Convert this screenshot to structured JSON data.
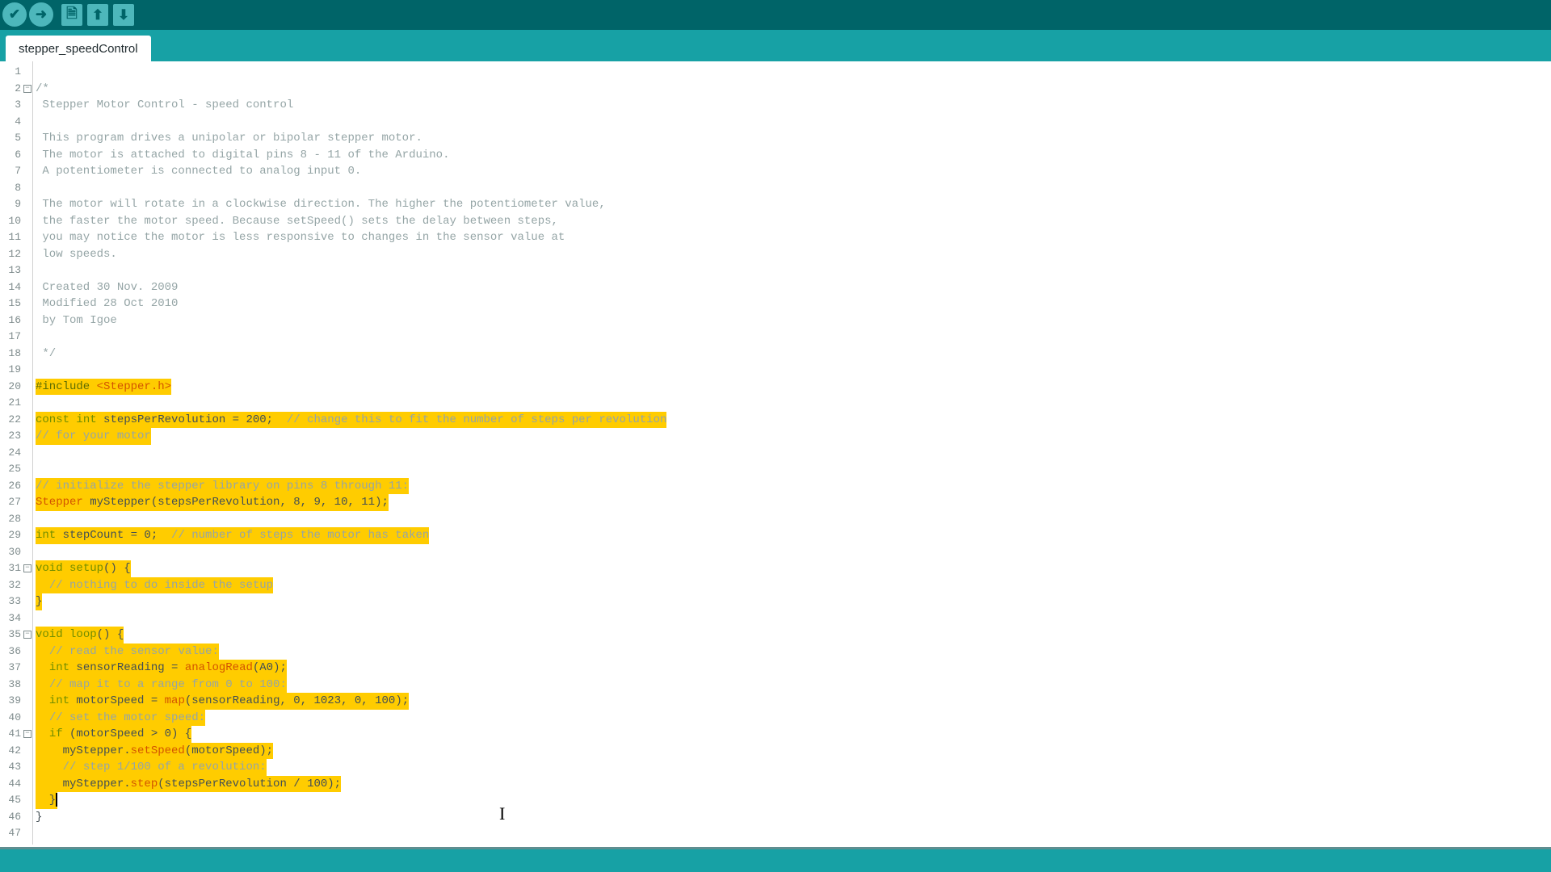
{
  "toolbar": {
    "buttons": [
      {
        "name": "verify",
        "icon": "checkmark-icon",
        "glyph": "✔"
      },
      {
        "name": "upload",
        "icon": "arrow-right-icon",
        "glyph": "➜"
      },
      {
        "name": "new",
        "icon": "new-file-icon",
        "glyph": "🗎"
      },
      {
        "name": "open",
        "icon": "arrow-up-icon",
        "glyph": "⬆"
      },
      {
        "name": "save",
        "icon": "arrow-down-icon",
        "glyph": "⬇"
      }
    ]
  },
  "tab": {
    "label": "stepper_speedControl"
  },
  "colors": {
    "toolbar": "#006468",
    "tabbar": "#17a1a5",
    "selection": "#ffcc00",
    "comment": "#95a5a6",
    "keyword": "#728e00",
    "function": "#d35400"
  },
  "editor": {
    "lines": [
      {
        "n": "1",
        "t": []
      },
      {
        "n": "2",
        "fold": true,
        "t": [
          [
            "comment",
            "/*"
          ]
        ]
      },
      {
        "n": "3",
        "t": [
          [
            "comment",
            " Stepper Motor Control - speed control"
          ]
        ]
      },
      {
        "n": "4",
        "t": []
      },
      {
        "n": "5",
        "t": [
          [
            "comment",
            " This program drives a unipolar or bipolar stepper motor."
          ]
        ]
      },
      {
        "n": "6",
        "t": [
          [
            "comment",
            " The motor is attached to digital pins 8 - 11 of the Arduino."
          ]
        ]
      },
      {
        "n": "7",
        "t": [
          [
            "comment",
            " A potentiometer is connected to analog input 0."
          ]
        ]
      },
      {
        "n": "8",
        "t": []
      },
      {
        "n": "9",
        "t": [
          [
            "comment",
            " The motor will rotate in a clockwise direction. The higher the potentiometer value,"
          ]
        ]
      },
      {
        "n": "10",
        "t": [
          [
            "comment",
            " the faster the motor speed. Because setSpeed() sets the delay between steps,"
          ]
        ]
      },
      {
        "n": "11",
        "t": [
          [
            "comment",
            " you may notice the motor is less responsive to changes in the sensor value at"
          ]
        ]
      },
      {
        "n": "12",
        "t": [
          [
            "comment",
            " low speeds."
          ]
        ]
      },
      {
        "n": "13",
        "t": []
      },
      {
        "n": "14",
        "t": [
          [
            "comment",
            " Created 30 Nov. 2009"
          ]
        ]
      },
      {
        "n": "15",
        "t": [
          [
            "comment",
            " Modified 28 Oct 2010"
          ]
        ]
      },
      {
        "n": "16",
        "t": [
          [
            "comment",
            " by Tom Igoe"
          ]
        ]
      },
      {
        "n": "17",
        "t": []
      },
      {
        "n": "18",
        "t": [
          [
            "comment",
            " */"
          ]
        ]
      },
      {
        "n": "19",
        "t": []
      },
      {
        "n": "20",
        "sel": true,
        "t": [
          [
            "pre",
            "#include "
          ],
          [
            "fn",
            "<Stepper.h>"
          ]
        ]
      },
      {
        "n": "21",
        "sel": true,
        "t": []
      },
      {
        "n": "22",
        "sel": true,
        "t": [
          [
            "kw",
            "const"
          ],
          [
            "text",
            " "
          ],
          [
            "kw",
            "int"
          ],
          [
            "text",
            " stepsPerRevolution = 200;  "
          ],
          [
            "comment",
            "// change this to fit the number of steps per revolution"
          ]
        ]
      },
      {
        "n": "23",
        "sel": true,
        "t": [
          [
            "comment",
            "// for your motor"
          ]
        ]
      },
      {
        "n": "24",
        "sel": true,
        "t": []
      },
      {
        "n": "25",
        "sel": true,
        "t": []
      },
      {
        "n": "26",
        "sel": true,
        "t": [
          [
            "comment",
            "// initialize the stepper library on pins 8 through 11:"
          ]
        ]
      },
      {
        "n": "27",
        "sel": true,
        "t": [
          [
            "fn",
            "Stepper"
          ],
          [
            "text",
            " myStepper(stepsPerRevolution, 8, 9, 10, 11);"
          ]
        ]
      },
      {
        "n": "28",
        "sel": true,
        "t": []
      },
      {
        "n": "29",
        "sel": true,
        "t": [
          [
            "kw",
            "int"
          ],
          [
            "text",
            " stepCount = 0;  "
          ],
          [
            "comment",
            "// number of steps the motor has taken"
          ]
        ]
      },
      {
        "n": "30",
        "sel": true,
        "t": []
      },
      {
        "n": "31",
        "fold": true,
        "sel": true,
        "t": [
          [
            "kw",
            "void"
          ],
          [
            "text",
            " "
          ],
          [
            "kw",
            "setup"
          ],
          [
            "text",
            "() {"
          ]
        ]
      },
      {
        "n": "32",
        "sel": true,
        "t": [
          [
            "text",
            "  "
          ],
          [
            "comment",
            "// nothing to do inside the setup"
          ]
        ]
      },
      {
        "n": "33",
        "sel": true,
        "t": [
          [
            "text",
            "}"
          ]
        ]
      },
      {
        "n": "34",
        "sel": true,
        "t": []
      },
      {
        "n": "35",
        "fold": true,
        "sel": true,
        "t": [
          [
            "kw",
            "void"
          ],
          [
            "text",
            " "
          ],
          [
            "kw",
            "loop"
          ],
          [
            "text",
            "() {"
          ]
        ]
      },
      {
        "n": "36",
        "sel": true,
        "t": [
          [
            "text",
            "  "
          ],
          [
            "comment",
            "// read the sensor value:"
          ]
        ]
      },
      {
        "n": "37",
        "sel": true,
        "t": [
          [
            "text",
            "  "
          ],
          [
            "kw",
            "int"
          ],
          [
            "text",
            " sensorReading = "
          ],
          [
            "fn",
            "analogRead"
          ],
          [
            "text",
            "(A0);"
          ]
        ]
      },
      {
        "n": "38",
        "sel": true,
        "t": [
          [
            "text",
            "  "
          ],
          [
            "comment",
            "// map it to a range from 0 to 100:"
          ]
        ]
      },
      {
        "n": "39",
        "sel": true,
        "t": [
          [
            "text",
            "  "
          ],
          [
            "kw",
            "int"
          ],
          [
            "text",
            " motorSpeed = "
          ],
          [
            "fn",
            "map"
          ],
          [
            "text",
            "(sensorReading, 0, 1023, 0, 100);"
          ]
        ]
      },
      {
        "n": "40",
        "sel": true,
        "t": [
          [
            "text",
            "  "
          ],
          [
            "comment",
            "// set the motor speed:"
          ]
        ]
      },
      {
        "n": "41",
        "fold": true,
        "sel": true,
        "t": [
          [
            "text",
            "  "
          ],
          [
            "kw",
            "if"
          ],
          [
            "text",
            " (motorSpeed > 0) {"
          ]
        ]
      },
      {
        "n": "42",
        "sel": true,
        "t": [
          [
            "text",
            "    myStepper."
          ],
          [
            "fn",
            "setSpeed"
          ],
          [
            "text",
            "(motorSpeed);"
          ]
        ]
      },
      {
        "n": "43",
        "sel": true,
        "t": [
          [
            "text",
            "    "
          ],
          [
            "comment",
            "// step 1/100 of a revolution:"
          ]
        ]
      },
      {
        "n": "44",
        "sel": true,
        "t": [
          [
            "text",
            "    myStepper."
          ],
          [
            "fn",
            "step"
          ],
          [
            "text",
            "(stepsPerRevolution / 100);"
          ]
        ]
      },
      {
        "n": "45",
        "sel": true,
        "caret": true,
        "t": [
          [
            "text",
            "  }"
          ]
        ]
      },
      {
        "n": "46",
        "t": [
          [
            "text",
            "}"
          ]
        ]
      },
      {
        "n": "47",
        "t": []
      }
    ]
  }
}
